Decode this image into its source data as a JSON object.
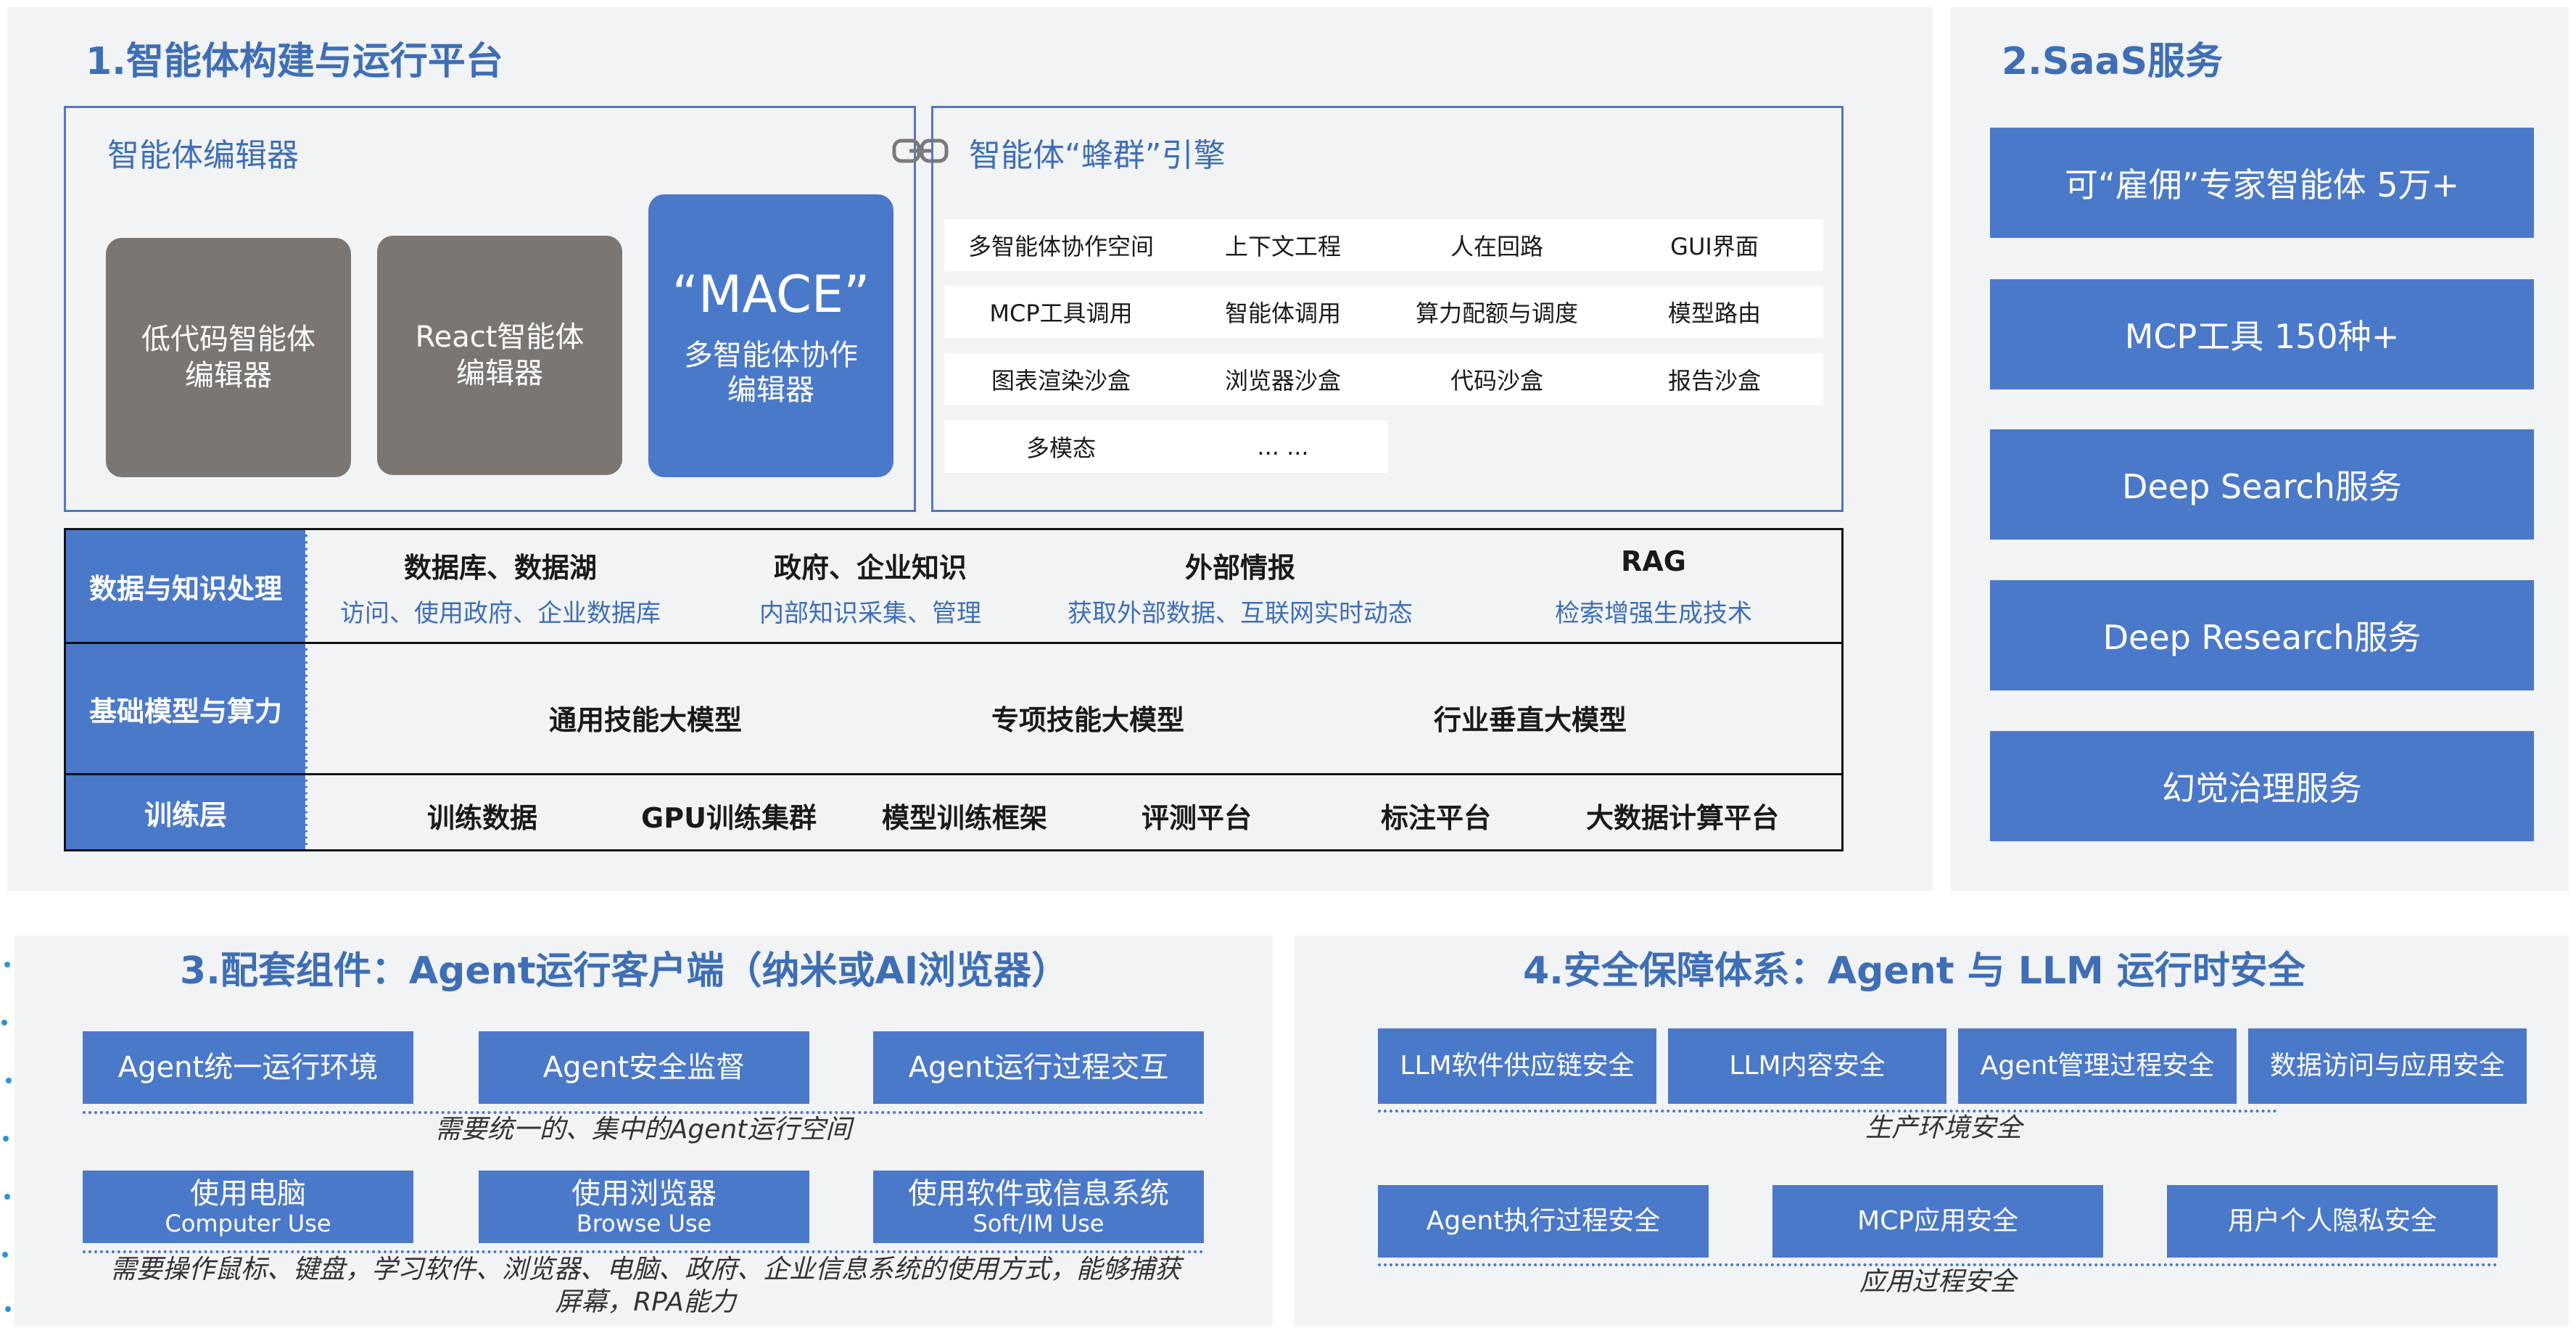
{
  "platform": {
    "title": "1.智能体构建与运行平台",
    "editor": {
      "title": "智能体编辑器",
      "cards": [
        {
          "label": "低代码智能体\n编辑器"
        },
        {
          "label": "React智能体\n编辑器"
        }
      ],
      "mace": {
        "headline": "“MACE”",
        "label": "多智能体协作\n编辑器"
      }
    },
    "engine": {
      "title": "智能体“蜂群”引擎",
      "rows": [
        [
          "多智能体协作空间",
          "上下文工程",
          "人在回路",
          "GUI界面"
        ],
        [
          "MCP工具调用",
          "智能体调用",
          "算力配额与调度",
          "模型路由"
        ],
        [
          "图表渲染沙盒",
          "浏览器沙盒",
          "代码沙盒",
          "报告沙盒"
        ],
        [
          "多模态",
          "... ..."
        ]
      ]
    },
    "layers": {
      "data": {
        "label": "数据与知识处理",
        "items": [
          {
            "title": "数据库、数据湖",
            "sub": "访问、使用政府、企业数据库"
          },
          {
            "title": "政府、企业知识",
            "sub": "内部知识采集、管理"
          },
          {
            "title": "外部情报",
            "sub": "获取外部数据、互联网实时动态"
          },
          {
            "title": "RAG",
            "sub": "检索增强生成技术"
          }
        ]
      },
      "model": {
        "label": "基础模型与算力",
        "items": [
          "通用技能大模型",
          "专项技能大模型",
          "行业垂直大模型"
        ]
      },
      "train": {
        "label": "训练层",
        "items": [
          "训练数据",
          "GPU训练集群",
          "模型训练框架",
          "评测平台",
          "标注平台",
          "大数据计算平台"
        ]
      }
    }
  },
  "saas": {
    "title": "2.SaaS服务",
    "items": [
      "可“雇佣”专家智能体 5万+",
      "MCP工具 150种+",
      "Deep Search服务",
      "Deep Research服务",
      "幻觉治理服务"
    ]
  },
  "components": {
    "title": "3.配套组件：Agent运行客户端（纳米或AI浏览器）",
    "row1": [
      "Agent统一运行环境",
      "Agent安全监督",
      "Agent运行过程交互"
    ],
    "note1": "需要统一的、集中的Agent运行空间",
    "row2": [
      {
        "main": "使用电脑",
        "sub": "Computer Use"
      },
      {
        "main": "使用浏览器",
        "sub": "Browse Use"
      },
      {
        "main": "使用软件或信息系统",
        "sub": "Soft/IM Use"
      }
    ],
    "note2": "需要操作鼠标、键盘，学习软件、浏览器、电脑、政府、企业信息系统的使用方式，能够捕获屏幕，RPA能力"
  },
  "security": {
    "title": "4.安全保障体系：Agent 与 LLM 运行时安全",
    "row1": [
      "LLM软件供应链安全",
      "LLM内容安全",
      "Agent管理过程安全",
      "数据访问与应用安全"
    ],
    "note1": "生产环境安全",
    "row2": [
      "Agent执行过程安全",
      "MCP应用安全",
      "用户个人隐私安全"
    ],
    "note2": "应用过程安全"
  },
  "colors": {
    "accent": "#4b79c9",
    "title": "#3e6fb5",
    "gray_card": "#7b7672",
    "panel_bg": "#f2f3f5"
  },
  "icons": {
    "link": "link-icon"
  }
}
